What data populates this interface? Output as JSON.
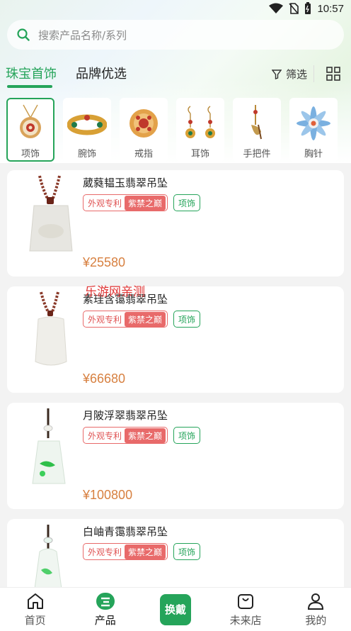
{
  "status": {
    "time": "10:57"
  },
  "search": {
    "placeholder": "搜索产品名称/系列"
  },
  "tabs": [
    {
      "label": "珠宝首饰"
    },
    {
      "label": "品牌优选"
    }
  ],
  "filter_label": "筛选",
  "categories": [
    {
      "label": "项饰"
    },
    {
      "label": "腕饰"
    },
    {
      "label": "戒指"
    },
    {
      "label": "耳饰"
    },
    {
      "label": "手把件"
    },
    {
      "label": "胸针"
    }
  ],
  "products": [
    {
      "name": "葳蕤韫玉翡翠吊坠",
      "tag1": "外观专利",
      "tag2": "紫禁之巅",
      "tag3": "项饰",
      "price": "¥25580"
    },
    {
      "name": "素珪含霭翡翠吊坠",
      "tag1": "外观专利",
      "tag2": "紫禁之巅",
      "tag3": "项饰",
      "price": "¥66680"
    },
    {
      "name": "月陂浮翠翡翠吊坠",
      "tag1": "外观专利",
      "tag2": "紫禁之巅",
      "tag3": "项饰",
      "price": "¥100800"
    },
    {
      "name": "白岫青霭翡翠吊坠",
      "tag1": "外观专利",
      "tag2": "紫禁之巅",
      "tag3": "项饰",
      "price": ""
    }
  ],
  "watermark": "乐游网亲测",
  "nav": [
    {
      "label": "首页"
    },
    {
      "label": "产品"
    },
    {
      "label": "换戴"
    },
    {
      "label": "未来店"
    },
    {
      "label": "我的"
    }
  ],
  "colors": {
    "accent": "#25a45a",
    "price": "#d78040",
    "tag_red": "#e86a6a"
  }
}
